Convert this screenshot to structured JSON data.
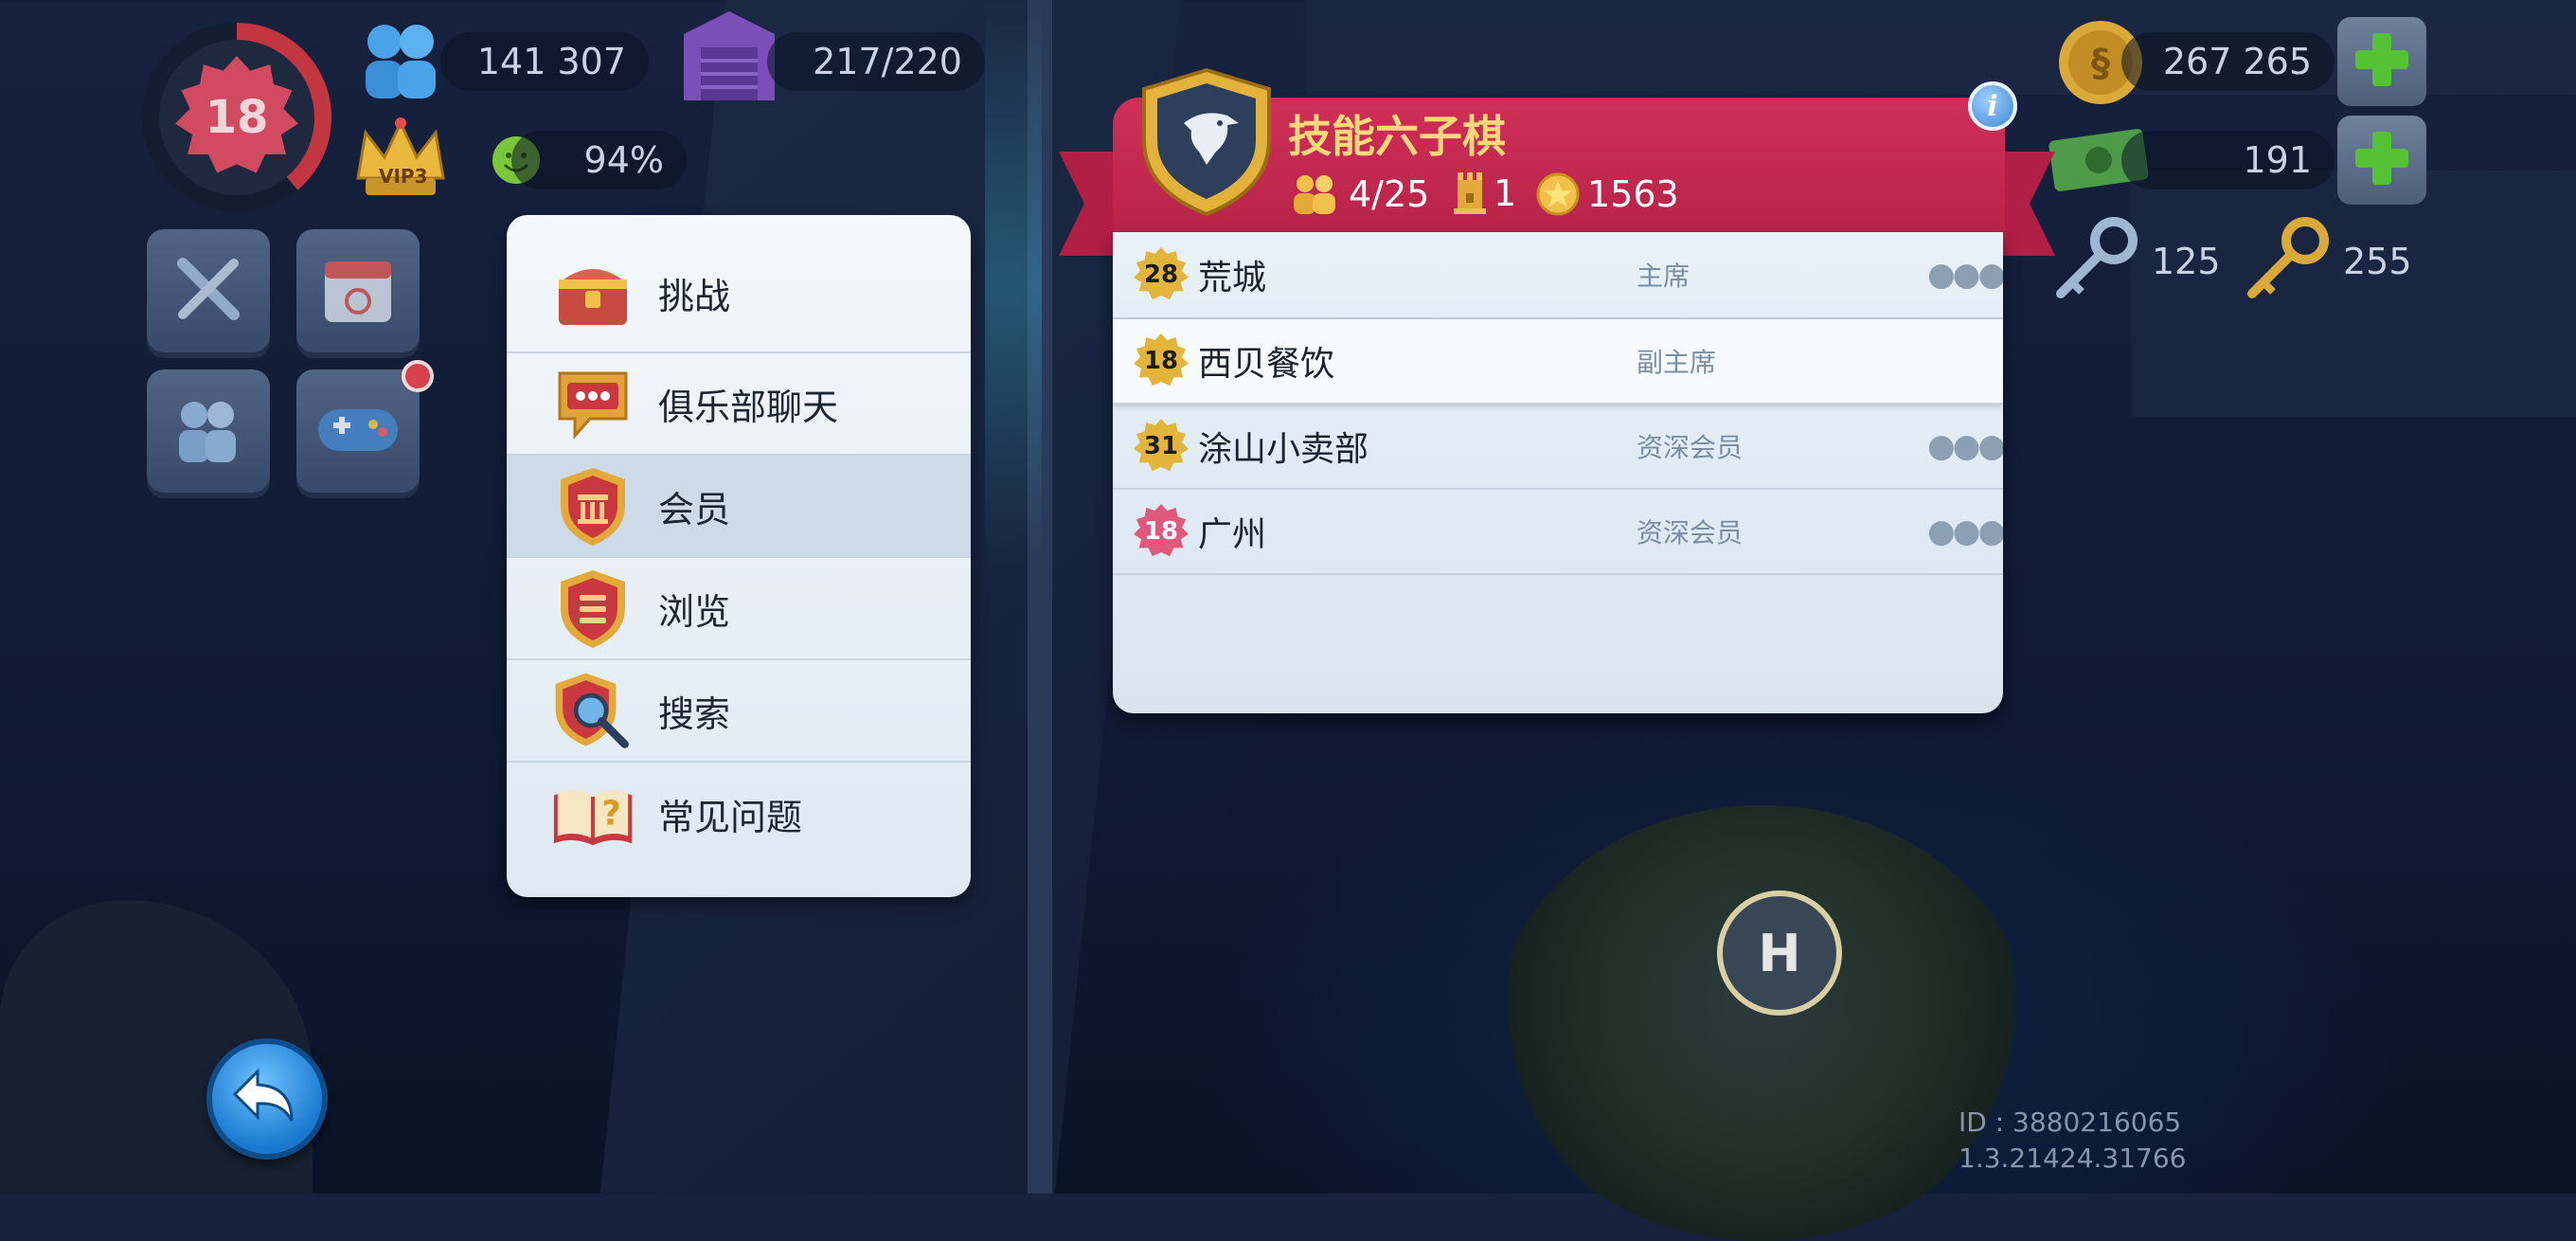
{
  "hud": {
    "level": "18",
    "population": "141 307",
    "storage": "217/220",
    "vip": "VIP3",
    "happiness": "94%",
    "simoleons": "267 265",
    "simcash": "191",
    "platinum_keys": "125",
    "golden_keys": "255"
  },
  "menu": {
    "items": [
      {
        "label": "挑战",
        "icon": "treasure-chest-icon"
      },
      {
        "label": "俱乐部聊天",
        "icon": "chat-bubble-icon"
      },
      {
        "label": "会员",
        "icon": "club-members-shield-icon"
      },
      {
        "label": "浏览",
        "icon": "browse-shield-icon"
      },
      {
        "label": "搜索",
        "icon": "search-shield-icon"
      },
      {
        "label": "常见问题",
        "icon": "faq-book-icon"
      }
    ],
    "active_index": 2
  },
  "club": {
    "name": "技能六子棋",
    "members": "4/25",
    "towers": "1",
    "points": "1563",
    "member_list": [
      {
        "level": "28",
        "name": "荒城",
        "role": "主席",
        "has_more": true,
        "badge_color": "#e3b53a"
      },
      {
        "level": "18",
        "name": "西贝餐饮",
        "role": "副主席",
        "has_more": false,
        "badge_color": "#e3b53a"
      },
      {
        "level": "31",
        "name": "涂山小卖部",
        "role": "资深会员",
        "has_more": true,
        "badge_color": "#e3b53a"
      },
      {
        "level": "18",
        "name": "广州",
        "role": "资深会员",
        "has_more": true,
        "badge_color": "#e0587a"
      }
    ]
  },
  "footer": {
    "id_text": "ID : 3880216065",
    "version": "1.3.21424.31766"
  },
  "colors": {
    "club_red": "#c72a51",
    "club_gold": "#ffd87a",
    "panel_bg": "#e9f1f8",
    "back_button": "#1a79cf"
  }
}
